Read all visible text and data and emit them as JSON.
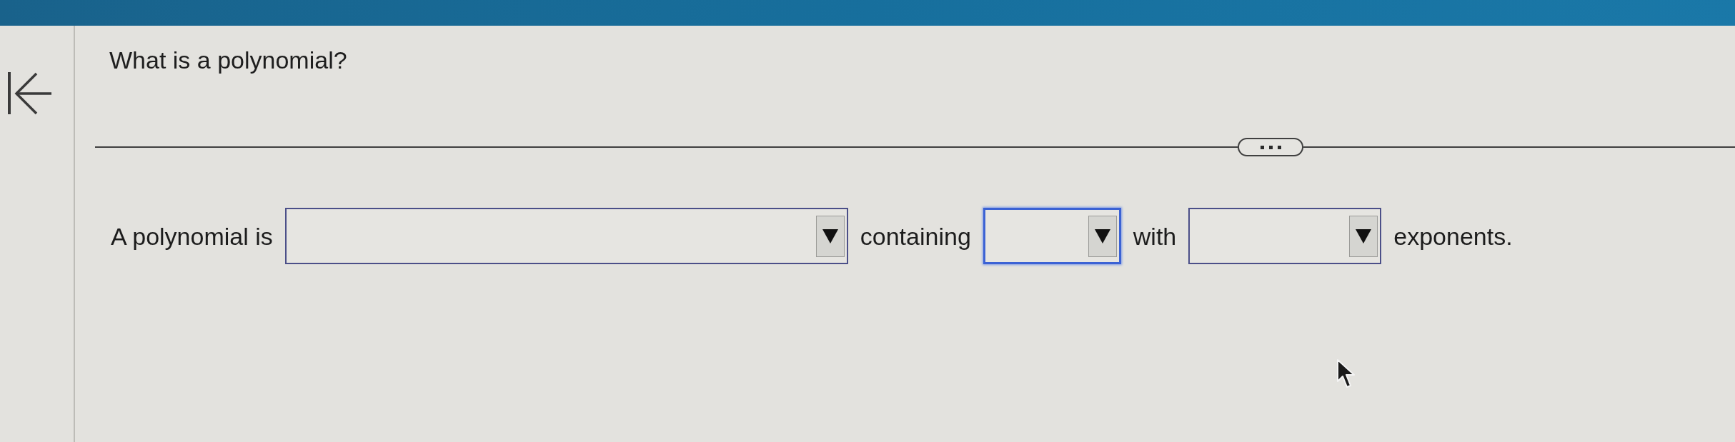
{
  "question": "What is a polynomial?",
  "answer": {
    "parts": [
      {
        "kind": "text",
        "text": "A polynomial is"
      },
      {
        "kind": "dropdown",
        "focused": false
      },
      {
        "kind": "text",
        "text": "containing"
      },
      {
        "kind": "dropdown",
        "focused": true
      },
      {
        "kind": "text",
        "text": "with"
      },
      {
        "kind": "dropdown",
        "focused": false
      },
      {
        "kind": "text",
        "text": "exponents."
      }
    ]
  }
}
